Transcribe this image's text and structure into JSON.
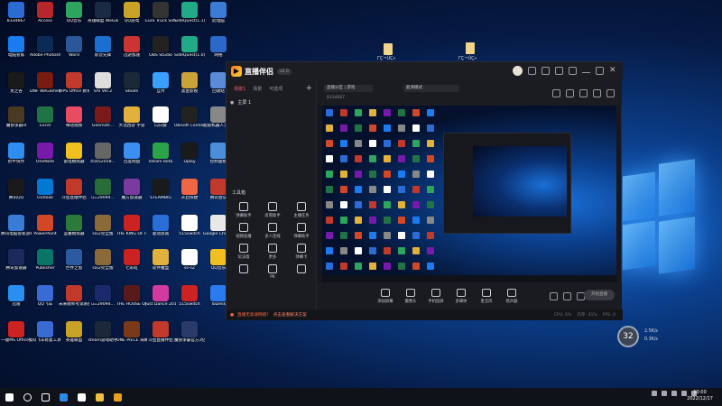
{
  "desktop_top_labels": [
    "ΓÇ¬ÚÇ«",
    "ΓÇ¬ÚÇ«"
  ],
  "desktop_icons": [
    {
      "label": "8334667",
      "color": "#2b6cd4"
    },
    {
      "label": "Access",
      "color": "#b7262d"
    },
    {
      "label": "QQ音乐",
      "color": "#2ea55e"
    },
    {
      "label": "英雄联盟 WeGame版",
      "color": "#1b2a44"
    },
    {
      "label": "QQ游戏",
      "color": "#c8a226"
    },
    {
      "label": "Euro Truck Simulator 2",
      "color": "#333"
    },
    {
      "label": "SideQuest(1.1)",
      "color": "#2a8"
    },
    {
      "label": "此电脑",
      "color": "#3a7bd5"
    },
    {
      "label": "电脑管家",
      "color": "#1a7cf0"
    },
    {
      "label": "Adobe Photosh...",
      "color": "#0b2a55"
    },
    {
      "label": "Word",
      "color": "#2b579a"
    },
    {
      "label": "影音先锋",
      "color": "#1b6fd1"
    },
    {
      "label": "迅游加速",
      "color": "#c33"
    },
    {
      "label": "OBS Studio",
      "color": "#222"
    },
    {
      "label": "SideQuest(1.0)",
      "color": "#2a8"
    },
    {
      "label": "网络",
      "color": "#2a68c9"
    },
    {
      "label": "龙之谷",
      "color": "#1a1a1a"
    },
    {
      "label": "DNF WeGame版",
      "color": "#7a1b12"
    },
    {
      "label": "WPS Office 教育考试专用",
      "color": "#c0392b"
    },
    {
      "label": "SAI Ver.2",
      "color": "#ddd"
    },
    {
      "label": "Steam",
      "color": "#1b2838"
    },
    {
      "label": "互传",
      "color": "#3aa0ff"
    },
    {
      "label": "黑金影视",
      "color": "#caa23a"
    },
    {
      "label": "回收站",
      "color": "#5a8bd6"
    },
    {
      "label": "魔兽争霸III",
      "color": "#4a3a22"
    },
    {
      "label": "Excel",
      "color": "#217346"
    },
    {
      "label": "咪咕视频",
      "color": "#e84c62"
    },
    {
      "label": "Geomotr...",
      "color": "#7a1a1a"
    },
    {
      "label": "大话西游 手游",
      "color": "#e2b13c"
    },
    {
      "label": "向日葵",
      "color": "#fff"
    },
    {
      "label": "Ubisoft Connect",
      "color": "#222"
    },
    {
      "label": "超级机器人大战X",
      "color": "#888"
    },
    {
      "label": "奶牛快传",
      "color": "#2f8df0"
    },
    {
      "label": "OneNote",
      "color": "#7719aa"
    },
    {
      "label": "雷电模拟器",
      "color": "#f0c020"
    },
    {
      "label": "45652058...",
      "color": "#666"
    },
    {
      "label": "百度网盘",
      "color": "#3a8ff0"
    },
    {
      "label": "Steam beta",
      "color": "#2aa34a"
    },
    {
      "label": "Uplay",
      "color": "#1a1a1a"
    },
    {
      "label": "控制面板",
      "color": "#4a8fd8"
    },
    {
      "label": "腾讯QQ",
      "color": "#1a1a1a"
    },
    {
      "label": "Outlook",
      "color": "#0078d4"
    },
    {
      "label": "斗鱼直播伴侣",
      "color": "#c0392b"
    },
    {
      "label": "u=29094...",
      "color": "#2a6b3a"
    },
    {
      "label": "魔方加速器",
      "color": "#7a3aa0"
    },
    {
      "label": "STEAMBIG",
      "color": "#1a1a1a"
    },
    {
      "label": "开启快捷",
      "color": "#e64"
    },
    {
      "label": "腾讯会议",
      "color": "#c0392b"
    },
    {
      "label": "腾讯电脑管家游戏中心",
      "color": "#3a7bd5"
    },
    {
      "label": "PowerPoint",
      "color": "#d24726"
    },
    {
      "label": "蓝叠模拟器",
      "color": "#2a7a3a"
    },
    {
      "label": "sai2完全版",
      "color": "#8a6a3a"
    },
    {
      "label": "THE KING OF FIGHT...",
      "color": "#c22"
    },
    {
      "label": "驱动总裁",
      "color": "#2a6fd8"
    },
    {
      "label": "515switch",
      "color": "#fff"
    },
    {
      "label": "Google Chrome",
      "color": "#e8e8e8"
    },
    {
      "label": "腾讯加速器",
      "color": "#1b2a5a"
    },
    {
      "label": "Publisher",
      "color": "#077568"
    },
    {
      "label": "世界之窗",
      "color": "#2a5aa0"
    },
    {
      "label": "sai2完全版",
      "color": "#8a6a3a"
    },
    {
      "label": "七彩虹",
      "color": "#c22"
    },
    {
      "label": "软件魔盒",
      "color": "#e2b13c"
    },
    {
      "label": "ss-sZ",
      "color": "#fff"
    },
    {
      "label": "QQ音乐",
      "color": "#f0c020"
    },
    {
      "label": "迅雷",
      "color": "#2a8ff0"
    },
    {
      "label": "QQ飞车",
      "color": "#3a6bd5"
    },
    {
      "label": "未来教师考试系统V4.0",
      "color": "#c0392b"
    },
    {
      "label": "u=29094...",
      "color": "#1a2a6a"
    },
    {
      "label": "THE HOUSE OF THE D...",
      "color": "#5a1a1a"
    },
    {
      "label": "Just Dance 2017",
      "color": "#d23aa0"
    },
    {
      "label": "515switch",
      "color": "#c22"
    },
    {
      "label": "ToDesk",
      "color": "#2a7bf0"
    },
    {
      "label": "一键MS Office授权",
      "color": "#c22"
    },
    {
      "label": "QQ飞车修复工具",
      "color": "#3a6bd5"
    },
    {
      "label": "英雄联盟",
      "color": "#c8a226"
    },
    {
      "label": "steam游戏助手",
      "color": "#1b2838"
    },
    {
      "label": "ONE PIECE 海贼无双4",
      "color": "#7a3a1a"
    },
    {
      "label": "斗鱼直播伴侣",
      "color": "#c0392b"
    },
    {
      "label": "魔兽争霸官方对战平台",
      "color": "#2a3a6a"
    }
  ],
  "app": {
    "name": "直播伴侣",
    "version": "v2.0",
    "scene_tabs": [
      "场景1",
      "场景",
      "可选项"
    ],
    "scene_item": "主屏 1",
    "tools_header": "工具箱",
    "tools": [
      {
        "label": "弹幕助手"
      },
      {
        "label": "房管助手"
      },
      {
        "label": "主播任务"
      },
      {
        "label": "视频直播"
      },
      {
        "label": "多人连线"
      },
      {
        "label": "弹幕助手"
      },
      {
        "label": "玩法墙"
      },
      {
        "label": "更多"
      },
      {
        "label": "弹幕卡"
      },
      {
        "label": ""
      },
      {
        "label": "PK"
      },
      {
        "label": ""
      }
    ],
    "top_fields": [
      "直播分区 | 游戏",
      "超清模式",
      "8334667"
    ],
    "bottom_buttons": [
      {
        "label": "添加屏幕"
      },
      {
        "label": "摄像头"
      },
      {
        "label": "手机投屏"
      },
      {
        "label": "多媒体"
      },
      {
        "label": "麦克风"
      },
      {
        "label": "扬声器"
      }
    ],
    "start_live": "开始直播",
    "status_alert": "直播无高速网络？",
    "status_text": "点击查看解决方案",
    "status_right": [
      "CPU: 6%",
      "内存: 41%",
      "FPS: 0"
    ]
  },
  "net_widget": {
    "value": "32",
    "up": "2.5K/s",
    "down": "0.3K/s"
  },
  "taskbar": {
    "apps": [
      {
        "name": "start",
        "color": "#ffffff"
      },
      {
        "name": "search",
        "color": "#ffffff"
      },
      {
        "name": "task-view",
        "color": "#ffffff"
      },
      {
        "name": "edge",
        "color": "#2b8ae5"
      },
      {
        "name": "store",
        "color": "#ffffff"
      },
      {
        "name": "explorer",
        "color": "#f0c040"
      },
      {
        "name": "live",
        "color": "#e8a020"
      }
    ],
    "time": "10:00",
    "date": "2022/12/17"
  }
}
